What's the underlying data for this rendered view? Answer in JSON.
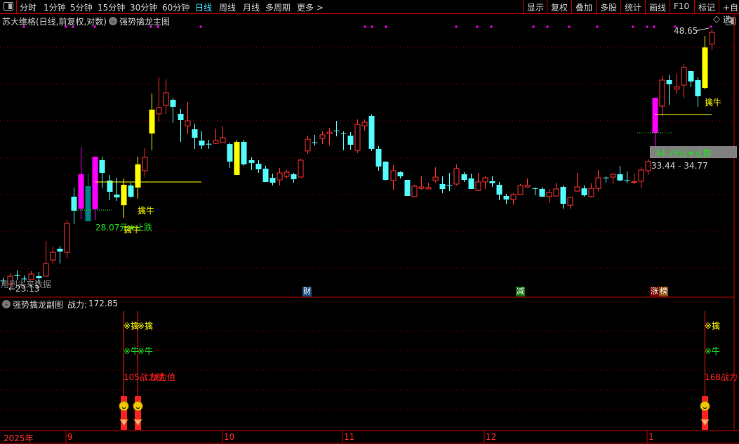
{
  "toolbar": {
    "tabs": [
      "分时",
      "1分钟",
      "5分钟",
      "15分钟",
      "30分钟",
      "60分钟",
      "日线",
      "周线",
      "月线",
      "多周期",
      "更多 >"
    ],
    "active_tab": "日线",
    "buttons": [
      "显示",
      "复权",
      "叠加",
      "多股",
      "统计",
      "画线",
      "F10",
      "标记",
      "+自选"
    ]
  },
  "main": {
    "title": "苏大维格(日线,前复权,对数)",
    "indicator": "强势擒龙主图",
    "high_label": "48.65",
    "low_label": "←23.13",
    "future_warning": "用到未来数据",
    "stop_label_1": "28.07元★止跌",
    "stop_label_2": "34.76元★止跌",
    "range_label": "33.44 - 34.77",
    "signal_label": "擒牛",
    "events": [
      "财",
      "减",
      "涨",
      "榜"
    ]
  },
  "sub": {
    "title": "强势擒龙副图",
    "power_label": "战力:",
    "power_value": "172.85",
    "sig_qin": "※擒",
    "sig_niu": "※牛",
    "power_text_1": "105战力值",
    "power_text_2": "战力值",
    "power_text_3": "168战力"
  },
  "date_axis": {
    "year": "2025年",
    "months": [
      "9",
      "10",
      "11",
      "12",
      "1"
    ]
  },
  "colors": {
    "up": "#ff3232",
    "down": "#54fcfc",
    "yellow": "#ffff00",
    "magenta": "#ff00ff",
    "teal": "#008080",
    "grid": "#8b0000"
  },
  "chart_data": {
    "type": "candlestick",
    "scale": "log",
    "series": [
      [
        25.47,
        25.44,
        25.67,
        25.21
      ],
      [
        25.25,
        25.76,
        25.94,
        25.07
      ],
      [
        25.82,
        25.78,
        26.13,
        25.53
      ],
      [
        25.6,
        25.57,
        25.8,
        25.34
      ],
      [
        25.53,
        25.9,
        26.09,
        25.53
      ],
      [
        25.76,
        25.62,
        26.04,
        25.34
      ],
      [
        25.76,
        26.61,
        28.2,
        25.76
      ],
      [
        26.85,
        27.39,
        27.79,
        26.56
      ],
      [
        27.64,
        27.44,
        27.84,
        26.61
      ],
      [
        27.39,
        29.5,
        29.76,
        26.95
      ],
      [
        31.6,
        30.48,
        32.35,
        29.45
      ],
      [
        30.64,
        33.47,
        35.92,
        29.82
      ],
      [
        32.46,
        29.66,
        33.53,
        29.66
      ],
      [
        30.59,
        35.02,
        35.02,
        29.76
      ],
      [
        34.71,
        33.59,
        35.02,
        32.28
      ],
      [
        32.94,
        32.0,
        33.41,
        31.31
      ],
      [
        31.77,
        31.54,
        33.17,
        31.26
      ],
      [
        32.58,
        30.91,
        33.11,
        29.92
      ],
      [
        32.52,
        31.6,
        32.76,
        31.48
      ],
      [
        32.35,
        34.33,
        35.02,
        31.43
      ],
      [
        33.78,
        34.96,
        35.79,
        33.23
      ],
      [
        37.17,
        39.52,
        41.2,
        35.6
      ],
      [
        39.1,
        39.74,
        42.95,
        38.33
      ],
      [
        39.95,
        41.27,
        42.72,
        39.1
      ],
      [
        40.53,
        39.81,
        40.75,
        38.19
      ],
      [
        39.1,
        38.47,
        39.59,
        36.37
      ],
      [
        37.91,
        38.4,
        40.31,
        37.1
      ],
      [
        37.58,
        36.77,
        38.12,
        35.73
      ],
      [
        36.5,
        36.04,
        37.37,
        35.73
      ],
      [
        36.2,
        36.17,
        36.57,
        35.73
      ],
      [
        36.24,
        36.5,
        37.64,
        36.17
      ],
      [
        36.3,
        36.77,
        37.84,
        36.3
      ],
      [
        36.17,
        34.58,
        36.3,
        34.02
      ],
      [
        36.37,
        33.41,
        36.57,
        33.41
      ],
      [
        36.37,
        34.33,
        36.57,
        34.21
      ],
      [
        34.71,
        34.46,
        34.96,
        33.84
      ],
      [
        34.39,
        33.9,
        34.71,
        33.59
      ],
      [
        33.96,
        32.82,
        34.21,
        32.82
      ],
      [
        33.17,
        32.76,
        33.53,
        32.52
      ],
      [
        32.99,
        33.59,
        34.02,
        32.52
      ],
      [
        33.29,
        33.65,
        33.84,
        33.11
      ],
      [
        33.47,
        33.05,
        33.59,
        32.76
      ],
      [
        33.23,
        34.71,
        34.83,
        33.23
      ],
      [
        35.54,
        36.63,
        36.97,
        35.28
      ],
      [
        36.33,
        36.3,
        37.04,
        36.04
      ],
      [
        36.71,
        37.04,
        37.37,
        36.17
      ],
      [
        37.17,
        37.3,
        37.71,
        36.04
      ],
      [
        37.46,
        37.43,
        38.4,
        36.9
      ],
      [
        37.23,
        37.17,
        37.37,
        35.6
      ],
      [
        36.97,
        36.11,
        37.3,
        35.66
      ],
      [
        35.6,
        38.05,
        38.54,
        35.34
      ],
      [
        37.91,
        38.26,
        38.54,
        37.44
      ],
      [
        38.89,
        35.73,
        39.03,
        35.54
      ],
      [
        35.73,
        34.14,
        35.98,
        33.78
      ],
      [
        34.58,
        32.99,
        34.58,
        32.94
      ],
      [
        32.94,
        33.78,
        34.27,
        32.17
      ],
      [
        33.65,
        33.29,
        33.72,
        33.11
      ],
      [
        32.99,
        31.65,
        32.99,
        31.65
      ],
      [
        31.6,
        32.46,
        32.58,
        31.6
      ],
      [
        32.28,
        32.4,
        33.29,
        32.17
      ],
      [
        32.23,
        32.35,
        32.76,
        32.23
      ],
      [
        32.94,
        33.23,
        34.08,
        32.76
      ],
      [
        32.64,
        32.23,
        33.29,
        31.88
      ],
      [
        32.54,
        32.52,
        33.59,
        32.05
      ],
      [
        32.64,
        33.96,
        34.33,
        32.52
      ],
      [
        33.47,
        32.99,
        33.65,
        32.82
      ],
      [
        33.11,
        32.23,
        33.53,
        32.23
      ],
      [
        32.11,
        32.82,
        33.59,
        32.05
      ],
      [
        32.82,
        33.17,
        33.29,
        32.23
      ],
      [
        32.88,
        32.7,
        33.29,
        32.4
      ],
      [
        32.58,
        31.77,
        32.82,
        31.31
      ],
      [
        31.65,
        31.37,
        31.82,
        31.03
      ],
      [
        31.37,
        31.77,
        31.88,
        30.97
      ],
      [
        31.77,
        32.52,
        32.64,
        31.77
      ],
      [
        32.4,
        32.52,
        33.11,
        32.35
      ],
      [
        32.3,
        32.28,
        32.35,
        31.71
      ],
      [
        32.23,
        31.6,
        32.4,
        31.6
      ],
      [
        31.6,
        31.94,
        32.23,
        31.09
      ],
      [
        31.65,
        32.23,
        32.76,
        31.65
      ],
      [
        32.4,
        31.03,
        32.52,
        30.64
      ],
      [
        30.91,
        31.54,
        31.6,
        30.64
      ],
      [
        32.05,
        32.4,
        33.59,
        32.05
      ],
      [
        32.28,
        31.71,
        32.52,
        31.6
      ],
      [
        31.6,
        32.28,
        32.7,
        31.54
      ],
      [
        32.28,
        33.17,
        33.84,
        32.05
      ],
      [
        33.19,
        33.17,
        33.29,
        32.76
      ],
      [
        33.23,
        33.47,
        33.53,
        32.64
      ],
      [
        33.47,
        32.94,
        34.21,
        32.88
      ],
      [
        32.96,
        32.94,
        33.72,
        32.7
      ],
      [
        32.82,
        32.84,
        33.53,
        32.64
      ],
      [
        32.88,
        33.84,
        34.08,
        32.28
      ],
      [
        33.78,
        34.58,
        34.77,
        33.44
      ],
      [
        37.23,
        40.75,
        40.75,
        35.85
      ],
      [
        39.88,
        42.64,
        43.13,
        38.89
      ],
      [
        42.64,
        42.18,
        43.21,
        40.02
      ],
      [
        41.66,
        41.89,
        43.37,
        41.12
      ],
      [
        42.1,
        44.05,
        44.45,
        40.75
      ],
      [
        43.65,
        42.49,
        43.65,
        41.89
      ],
      [
        42.64,
        40.9,
        42.95,
        39.81
      ],
      [
        41.79,
        46.38,
        47.78,
        41.66
      ],
      [
        46.77,
        48.21,
        48.65,
        46.08
      ]
    ],
    "special_colors": {
      "11": "magenta",
      "12": "teal",
      "13": "magenta",
      "17": "yellow",
      "19": "yellow",
      "21": "yellow",
      "33": "yellow",
      "92": "magenta",
      "99": "yellow"
    },
    "high": 48.65,
    "low_offscreen": 23.13
  }
}
